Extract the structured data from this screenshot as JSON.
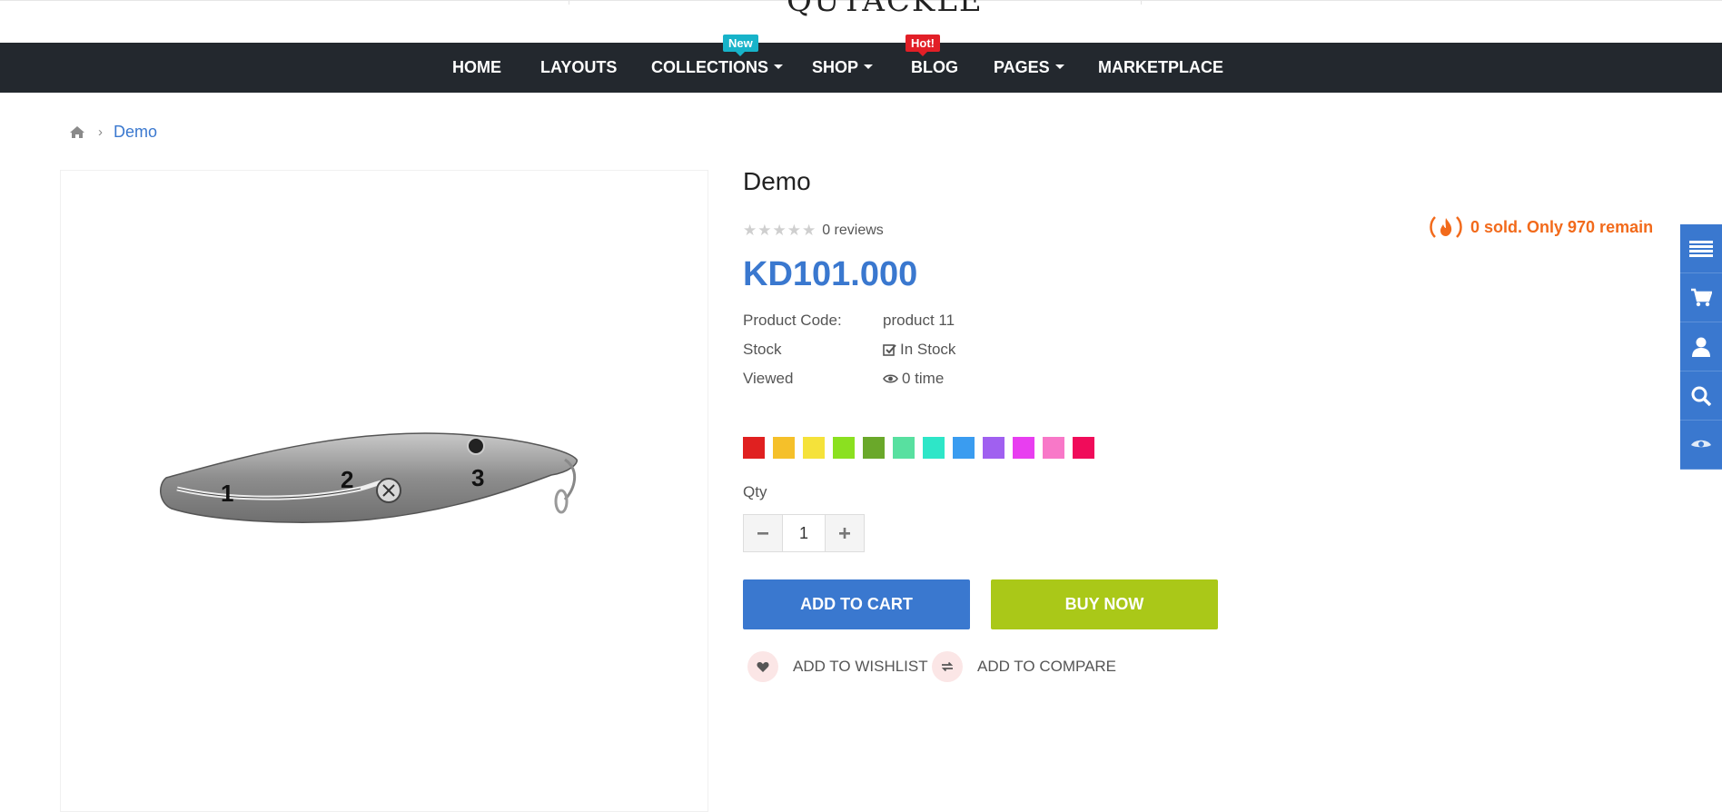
{
  "header": {
    "logo_text": "QUTACKLE"
  },
  "nav": {
    "items": [
      {
        "label": "HOME"
      },
      {
        "label": "LAYOUTS"
      },
      {
        "label": "COLLECTIONS",
        "badge": "New"
      },
      {
        "label": "SHOP"
      },
      {
        "label": "BLOG",
        "badge": "Hot!"
      },
      {
        "label": "PAGES"
      },
      {
        "label": "MARKETPLACE"
      }
    ]
  },
  "breadcrumb": {
    "home_icon": "home-icon",
    "current": "Demo"
  },
  "product": {
    "title": "Demo",
    "reviews": "0 reviews",
    "rating_stars": 0,
    "sold_info": "0 sold. Only 970 remain",
    "price": "KD101.000",
    "specs": {
      "code_label": "Product Code:",
      "code_value": "product 11",
      "stock_label": "Stock",
      "stock_value": "In Stock",
      "viewed_label": "Viewed",
      "viewed_value": "0 time"
    },
    "image_labels": [
      "1",
      "2",
      "3"
    ],
    "colors": [
      "#e02020",
      "#f5c02a",
      "#f5e23a",
      "#8be020",
      "#6aa82a",
      "#58e0a0",
      "#2ee6c8",
      "#3a9cf0",
      "#a060f0",
      "#e83ef0",
      "#f878c8",
      "#f00c5a"
    ],
    "qty_label": "Qty",
    "qty_value": "1",
    "add_to_cart": "ADD TO CART",
    "buy_now": "BUY NOW",
    "add_to_wishlist": "ADD TO WISHLIST",
    "add_to_compare": "ADD TO COMPARE"
  },
  "sidebar": {
    "icons": [
      "list-icon",
      "cart-icon",
      "user-icon",
      "search-icon",
      "eye-icon"
    ],
    "accent": "#3a78cf"
  }
}
